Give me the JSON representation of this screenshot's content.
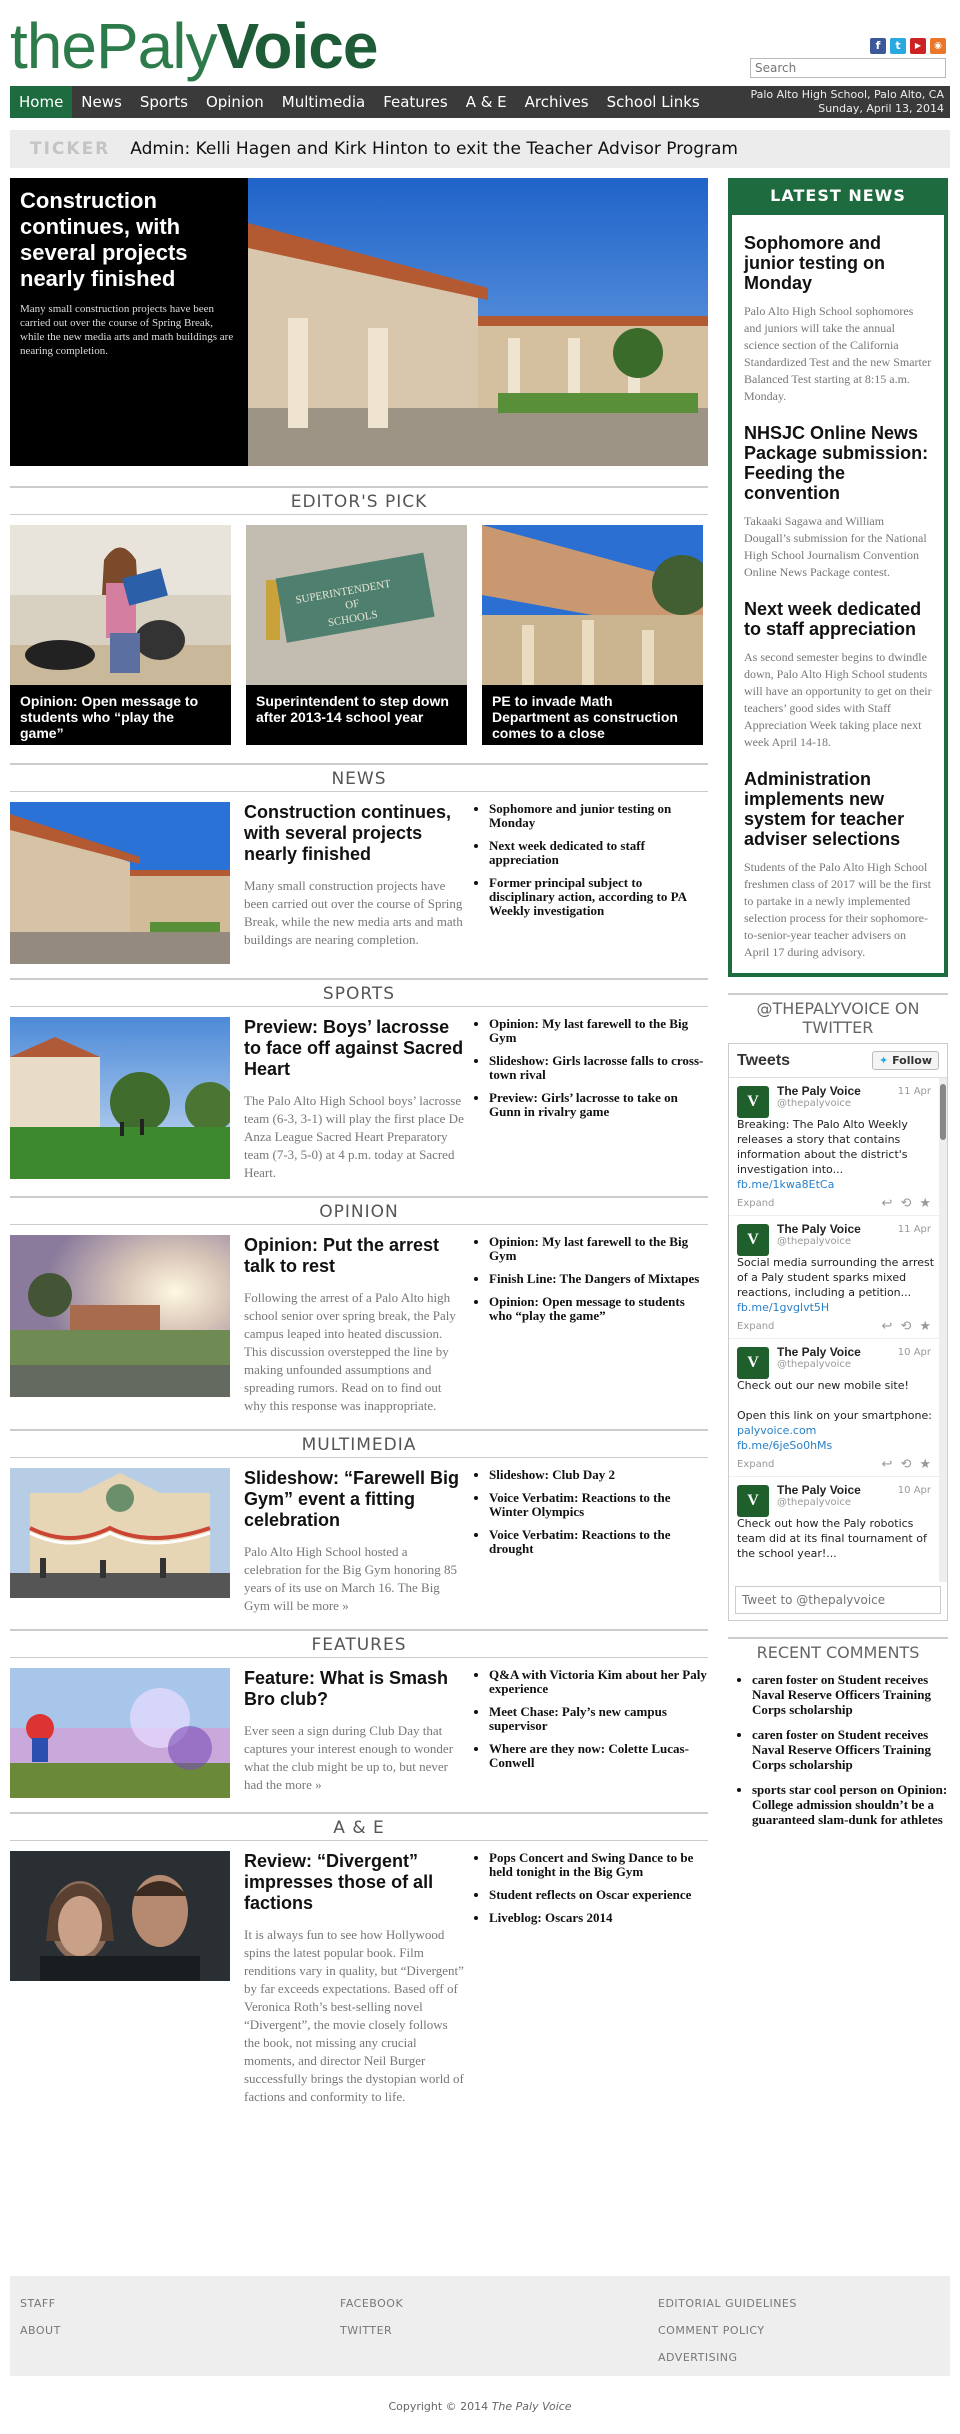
{
  "site": {
    "logo_the": "the",
    "logo_paly": "Paly",
    "logo_voice": "Voice",
    "search_placeholder": "Search",
    "location": "Palo Alto High School, Palo Alto, CA",
    "date": "Sunday, April 13, 2014"
  },
  "nav": [
    "Home",
    "News",
    "Sports",
    "Opinion",
    "Multimedia",
    "Features",
    "A & E",
    "Archives",
    "School Links"
  ],
  "ticker": {
    "label": "TICKER",
    "text": "Admin: Kelli Hagen and Kirk Hinton to exit the Teacher Advisor Program"
  },
  "featured": {
    "title": "Construction continues, with several projects nearly finished",
    "summary": "Many small construction projects have been carried out over the course of Spring Break, while the new media arts and math buildings are nearing completion."
  },
  "editors_pick": {
    "heading": "EDITOR'S PICK",
    "items": [
      {
        "caption": "Opinion: Open message to students who “play the game”"
      },
      {
        "caption": "Superintendent to step down after 2013-14 school year"
      },
      {
        "caption": "PE to invade Math Department as construction comes to a close"
      }
    ],
    "sign_text_1": "SUPERINTENDENT",
    "sign_text_2": "OF",
    "sign_text_3": "SCHOOLS"
  },
  "sections": [
    {
      "heading": "NEWS",
      "title": "Construction continues, with several projects nearly finished",
      "summary": "Many small construction projects have been carried out over the course of Spring Break, while the new media arts and math buildings are nearing completion.",
      "links": [
        "Sophomore and junior testing on Monday",
        "Next week dedicated to staff appreciation",
        "Former principal subject to disciplinary action, according to PA Weekly investigation"
      ]
    },
    {
      "heading": "SPORTS",
      "title": "Preview: Boys’ lacrosse to face off against Sacred Heart",
      "summary": "The Palo Alto High School boys’ lacrosse team (6-3, 3-1) will play the first place De Anza League Sacred Heart Preparatory team (7-3, 5-0) at 4 p.m. today at Sacred Heart.",
      "links": [
        "Opinion: My last farewell to the Big Gym",
        "Slideshow: Girls lacrosse falls to cross-town rival",
        "Preview: Girls’ lacrosse to take on Gunn in rivalry game"
      ]
    },
    {
      "heading": "OPINION",
      "title": "Opinion: Put the arrest talk to rest",
      "summary": "Following the arrest of a Palo Alto high school senior over spring break, the Paly campus leaped into heated discussion. This discussion overstepped the line by making unfounded assumptions and spreading rumors. Read on to find out why this response was inappropriate.",
      "links": [
        "Opinion: My last farewell to the Big Gym",
        "Finish Line: The Dangers of Mixtapes",
        "Opinion: Open message to students who “play the game”"
      ]
    },
    {
      "heading": "MULTIMEDIA",
      "title": "Slideshow: “Farewell Big Gym” event a fitting celebration",
      "summary": "Palo Alto High School hosted a celebration for the Big Gym honoring 85 years of its use on March 16. The Big Gym will be more »",
      "links": [
        "Slideshow: Club Day 2",
        "Voice Verbatim: Reactions to the Winter Olympics",
        "Voice Verbatim: Reactions to the drought"
      ]
    },
    {
      "heading": "FEATURES",
      "title": "Feature: What is Smash Bro club?",
      "summary": "Ever seen a sign during Club Day that captures your interest enough to wonder what the club might be up to, but never had the more »",
      "links": [
        "Q&A with Victoria Kim about her Paly experience",
        "Meet Chase: Paly’s new campus supervisor",
        "Where are they now: Colette Lucas-Conwell"
      ]
    },
    {
      "heading": "A & E",
      "title": "Review: “Divergent” impresses those of all factions",
      "summary": "It is always fun to see how Hollywood spins the latest popular book. Film renditions vary in quality, but “Divergent” by far exceeds expectations. Based off of Veronica Roth’s best-selling novel “Divergent”, the movie closely follows the book, not missing any crucial moments, and director Neil Burger successfully brings the dystopian world of factions and conformity to life.",
      "links": [
        "Pops Concert and Swing Dance to be held tonight in the Big Gym",
        "Student reflects on Oscar experience",
        "Liveblog: Oscars 2014"
      ]
    }
  ],
  "latest_news": {
    "heading": "LATEST NEWS",
    "items": [
      {
        "title": "Sophomore and junior testing on Monday",
        "summary": "Palo Alto High School sophomores and juniors will take the annual science section of the California Standardized Test and the new Smarter Balanced Test starting at 8:15 a.m. Monday."
      },
      {
        "title": "NHSJC Online News Package submission: Feeding the convention",
        "summary": "Takaaki Sagawa and William Dougall’s submission for the National High School Journalism Convention Online News Package contest."
      },
      {
        "title": "Next week dedicated to staff appreciation",
        "summary": "As second semester begins to dwindle down, Palo Alto High School students will have an opportunity to get on their teachers’ good sides with Staff Appreciation Week taking place next week April 14-18."
      },
      {
        "title": "Administration implements new system for teacher adviser selections",
        "summary": "Students of the Palo Alto High School freshmen class of 2017 will be the first to partake in a newly implemented selection process for their sophomore-to-senior-year teacher advisers on April 17 during advisory."
      }
    ]
  },
  "twitter": {
    "heading": "@THEPALYVOICE ON TWITTER",
    "label": "Tweets",
    "follow": "Follow",
    "input_placeholder": "Tweet to @thepalyvoice",
    "tweets": [
      {
        "name": "The Paly Voice",
        "handle": "@thepalyvoice",
        "date": "11 Apr",
        "text": "Breaking: The Palo Alto Weekly releases a story that contains information about the district's investigation into...",
        "link": "fb.me/1kwa8EtCa",
        "expand": "Expand"
      },
      {
        "name": "The Paly Voice",
        "handle": "@thepalyvoice",
        "date": "11 Apr",
        "text": "Social media surrounding the arrest of a Paly student sparks mixed reactions, including a petition...",
        "link": "fb.me/1gvglvt5H",
        "expand": "Expand"
      },
      {
        "name": "The Paly Voice",
        "handle": "@thepalyvoice",
        "date": "10 Apr",
        "text": "Check out our new mobile site!\n\nOpen this link on your smartphone:",
        "link": "palyvoice.com",
        "link2": "fb.me/6jeSo0hMs",
        "expand": "Expand"
      },
      {
        "name": "The Paly Voice",
        "handle": "@thepalyvoice",
        "date": "10 Apr",
        "text": "Check out how the Paly robotics team did at its final tournament of the school year!...",
        "link": "",
        "expand": ""
      }
    ]
  },
  "recent_comments": {
    "heading": "RECENT COMMENTS",
    "items": [
      "caren foster on Student receives Naval Reserve Officers Training Corps scholarship",
      "caren foster on Student receives Naval Reserve Officers Training Corps scholarship",
      "sports star cool person on Opinion: College admission shouldn’t be a guaranteed slam-dunk for athletes"
    ]
  },
  "footer": {
    "col1": [
      "STAFF",
      "ABOUT"
    ],
    "col2": [
      "FACEBOOK",
      "TWITTER"
    ],
    "col3": [
      "EDITORIAL GUIDELINES",
      "COMMENT POLICY",
      "ADVERTISING"
    ],
    "copyright": "Copyright © 2014",
    "copyright_name": "The Paly Voice"
  },
  "colors": {
    "brand_green": "#1d6b3e",
    "nav_bg": "#3a3a3a"
  }
}
